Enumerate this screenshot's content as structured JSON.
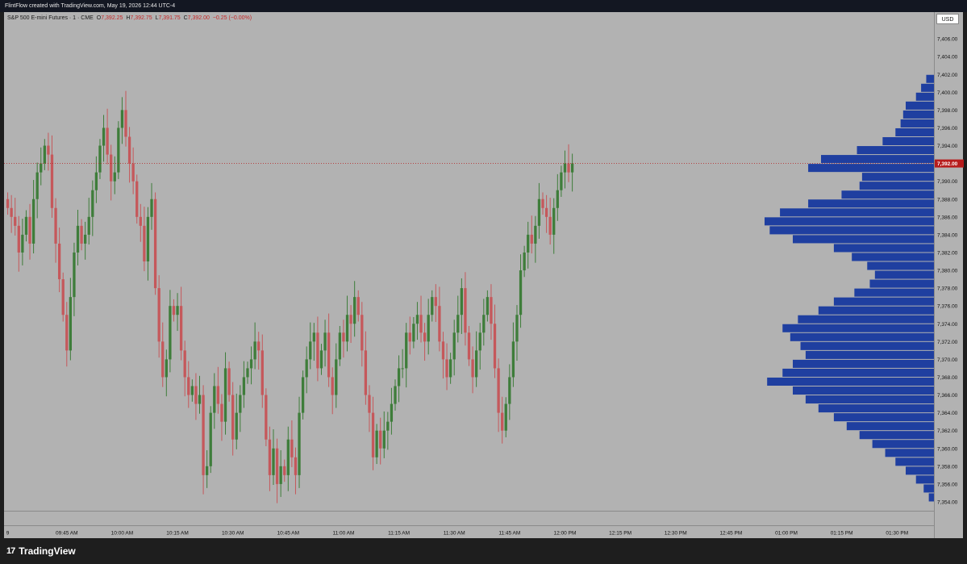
{
  "header": {
    "attribution": "FlintFlow created with TradingView.com, May 19, 2026 12:44 UTC-4"
  },
  "legend": {
    "symbol": "S&P 500 E-mini Futures · 1 · CME",
    "open_label": "O",
    "open": "7,392.25",
    "high_label": "H",
    "high": "7,392.75",
    "low_label": "L",
    "low": "7,391.75",
    "close_label": "C",
    "close": "7,392.00",
    "change": "−0.25 (−0.00%)"
  },
  "price_axis": {
    "currency": "USD",
    "current_price_label": "7,392.00"
  },
  "branding": {
    "logo_mark": "17",
    "name": "TradingView"
  },
  "colors": {
    "background": "#b2b2b2",
    "up_candle": "#3e7d3a",
    "down_candle": "#c5585b",
    "volume_profile": "#1f3fa0",
    "price_marker": "#b71c1c"
  },
  "chart_data": {
    "type": "candlestick",
    "interval": "1 minute",
    "ylim": [
      7353,
      7409
    ],
    "y_ticks": [
      7354,
      7356,
      7358,
      7360,
      7362,
      7364,
      7366,
      7368,
      7370,
      7372,
      7374,
      7376,
      7378,
      7380,
      7382,
      7384,
      7386,
      7388,
      7390,
      7392,
      7394,
      7396,
      7398,
      7400,
      7402,
      7404,
      7406,
      7408
    ],
    "y_tick_labels": [
      "7,354.00",
      "7,356.00",
      "7,358.00",
      "7,360.00",
      "7,362.00",
      "7,364.00",
      "7,366.00",
      "7,368.00",
      "7,370.00",
      "7,372.00",
      "7,374.00",
      "7,376.00",
      "7,378.00",
      "7,380.00",
      "7,382.00",
      "7,384.00",
      "7,386.00",
      "7,388.00",
      "7,390.00",
      "7,392.00",
      "7,394.00",
      "7,396.00",
      "7,398.00",
      "7,400.00",
      "7,402.00",
      "7,404.00",
      "7,406.00",
      "7,408.00"
    ],
    "x_tick_labels": [
      "9",
      "09:45 AM",
      "10:00 AM",
      "10:15 AM",
      "10:30 AM",
      "10:45 AM",
      "11:00 AM",
      "11:15 AM",
      "11:30 AM",
      "11:45 AM",
      "12:00 PM",
      "12:15 PM",
      "12:30 PM",
      "12:45 PM",
      "01:00 PM",
      "01:15 PM",
      "01:30 PM"
    ],
    "x_tick_minutes": [
      -16,
      0,
      15,
      30,
      45,
      60,
      75,
      90,
      105,
      120,
      135,
      150,
      165,
      180,
      195,
      210,
      225
    ],
    "x_minute_range": [
      -17,
      235
    ],
    "candle_start_minute": -16,
    "current_price": 7392,
    "closes": [
      7387,
      7386,
      7385,
      7382,
      7384,
      7386,
      7383,
      7388,
      7391,
      7392,
      7394,
      7393,
      7387,
      7383,
      7379,
      7375,
      7371,
      7377,
      7382,
      7385,
      7383,
      7384,
      7386,
      7389,
      7391,
      7394,
      7396,
      7393,
      7390,
      7391,
      7396,
      7398,
      7395,
      7392,
      7390,
      7386,
      7385,
      7381,
      7386,
      7388,
      7378,
      7372,
      7368,
      7370,
      7376,
      7375,
      7376,
      7371,
      7368,
      7366,
      7367,
      7365,
      7366,
      7357,
      7358,
      7364,
      7367,
      7365,
      7363,
      7369,
      7366,
      7361,
      7364,
      7366,
      7368,
      7369,
      7370,
      7372,
      7371,
      7366,
      7361,
      7357,
      7360,
      7356,
      7358,
      7357,
      7361,
      7359,
      7357,
      7364,
      7368,
      7370,
      7372,
      7373,
      7369,
      7371,
      7373,
      7368,
      7366,
      7370,
      7373,
      7372,
      7375,
      7374,
      7377,
      7375,
      7371,
      7366,
      7364,
      7359,
      7362,
      7360,
      7362,
      7363,
      7365,
      7367,
      7369,
      7369,
      7373,
      7372,
      7374,
      7375,
      7373,
      7372,
      7375,
      7377,
      7376,
      7372,
      7370,
      7368,
      7370,
      7373,
      7375,
      7378,
      7373,
      7370,
      7368,
      7371,
      7373,
      7375,
      7377,
      7374,
      7369,
      7364,
      7362,
      7365,
      7368,
      7372,
      7375,
      7380,
      7382,
      7384,
      7383,
      7385,
      7388,
      7387,
      7386,
      7384,
      7387,
      7389,
      7391,
      7392,
      7391,
      7392
    ],
    "volume_profile": [
      {
        "price": 7354.5,
        "volume": 4
      },
      {
        "price": 7355.5,
        "volume": 8
      },
      {
        "price": 7356.5,
        "volume": 14
      },
      {
        "price": 7357.5,
        "volume": 22
      },
      {
        "price": 7358.5,
        "volume": 30
      },
      {
        "price": 7359.5,
        "volume": 38
      },
      {
        "price": 7360.5,
        "volume": 48
      },
      {
        "price": 7361.5,
        "volume": 58
      },
      {
        "price": 7362.5,
        "volume": 68
      },
      {
        "price": 7363.5,
        "volume": 78
      },
      {
        "price": 7364.5,
        "volume": 90
      },
      {
        "price": 7365.5,
        "volume": 100
      },
      {
        "price": 7366.5,
        "volume": 110
      },
      {
        "price": 7367.5,
        "volume": 130
      },
      {
        "price": 7368.5,
        "volume": 118
      },
      {
        "price": 7369.5,
        "volume": 110
      },
      {
        "price": 7370.5,
        "volume": 100
      },
      {
        "price": 7371.5,
        "volume": 104
      },
      {
        "price": 7372.5,
        "volume": 112
      },
      {
        "price": 7373.5,
        "volume": 118
      },
      {
        "price": 7374.5,
        "volume": 106
      },
      {
        "price": 7375.5,
        "volume": 90
      },
      {
        "price": 7376.5,
        "volume": 78
      },
      {
        "price": 7377.5,
        "volume": 62
      },
      {
        "price": 7378.5,
        "volume": 50
      },
      {
        "price": 7379.5,
        "volume": 46
      },
      {
        "price": 7380.5,
        "volume": 52
      },
      {
        "price": 7381.5,
        "volume": 64
      },
      {
        "price": 7382.5,
        "volume": 78
      },
      {
        "price": 7383.5,
        "volume": 110
      },
      {
        "price": 7384.5,
        "volume": 128
      },
      {
        "price": 7385.5,
        "volume": 132
      },
      {
        "price": 7386.5,
        "volume": 120
      },
      {
        "price": 7387.5,
        "volume": 98
      },
      {
        "price": 7388.5,
        "volume": 72
      },
      {
        "price": 7389.5,
        "volume": 58
      },
      {
        "price": 7390.5,
        "volume": 56
      },
      {
        "price": 7391.5,
        "volume": 98
      },
      {
        "price": 7392.5,
        "volume": 88
      },
      {
        "price": 7393.5,
        "volume": 60
      },
      {
        "price": 7394.5,
        "volume": 40
      },
      {
        "price": 7395.5,
        "volume": 30
      },
      {
        "price": 7396.5,
        "volume": 26
      },
      {
        "price": 7397.5,
        "volume": 24
      },
      {
        "price": 7398.5,
        "volume": 22
      },
      {
        "price": 7399.5,
        "volume": 14
      },
      {
        "price": 7400.5,
        "volume": 10
      },
      {
        "price": 7401.5,
        "volume": 6
      }
    ]
  }
}
